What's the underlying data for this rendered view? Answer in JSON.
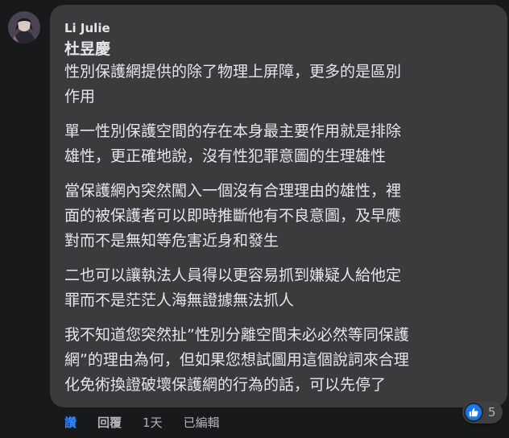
{
  "comment": {
    "author": "Li Julie",
    "mention": "杜昱慶",
    "paragraphs": [
      "性別保護網提供的除了物理上屏障，更多的是區別\n作用",
      "單一性別保護空間的存在本身最主要作用就是排除\n雄性，更正確地說，沒有性犯罪意圖的生理雄性",
      "當保護網內突然闖入一個沒有合理理由的雄性，裡\n面的被保護者可以即時推斷他有不良意圖，及早應\n對而不是無知等危害近身和發生",
      "二也可以讓執法人員得以更容易抓到嫌疑人給他定\n罪而不是茫茫人海無證據無法抓人",
      "我不知道您突然扯”性別分離空間未必必然等同保護\n網”的理由為何，但如果您想試圖用這個說詞來合理\n化免術換證破壞保護網的行為的話，可以先停了"
    ],
    "actions": {
      "like": "讚",
      "reply": "回覆",
      "time": "1天",
      "edited": "已編輯"
    },
    "reactions": {
      "icon": "thumbs-up-icon",
      "count": "5",
      "color": "#1877f2"
    }
  }
}
